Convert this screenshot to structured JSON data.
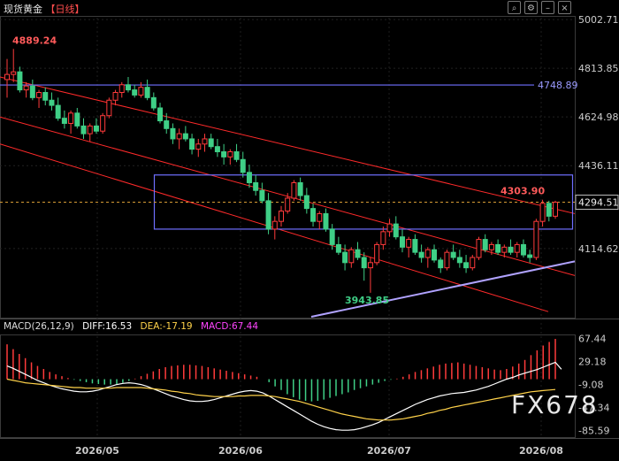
{
  "header": {
    "instrument": "现货黄金",
    "period": "【日线】"
  },
  "toolbar": {
    "icons": [
      "search-icon",
      "settings-icon",
      "minus-icon",
      "close-icon"
    ]
  },
  "watermark": "FX678",
  "macd": {
    "label": "MACD(26,12,9)",
    "diff": "DIFF:16.53",
    "dea": "DEA:-17.19",
    "macd": "MACD:67.44",
    "colors": {
      "diff": "#ffffff",
      "dea": "#ffd24a",
      "macd": "#ff44ff"
    }
  },
  "chart_data": [
    {
      "type": "candlestick",
      "title": "现货黄金 日线",
      "y_ticks": [
        "5002.71",
        "4813.85",
        "4624.98",
        "4436.11",
        "4114.62"
      ],
      "last_price": "4294.51",
      "annotations": {
        "high": "4889.24",
        "low": "3943.85",
        "recent_high": "4303.90",
        "level": "4748.89"
      },
      "x_ticks": [
        "2026/05",
        "2026/06",
        "2026/07",
        "2026/08"
      ],
      "colors": {
        "up": "#ff3b3b",
        "down": "#3fcf86",
        "channel": "#ff2a2a",
        "rect": "#6f6fff",
        "support": "#b0a2ff"
      },
      "candles": [
        [
          4770,
          4850,
          4700,
          4790
        ],
        [
          4790,
          4889,
          4760,
          4800
        ],
        [
          4800,
          4820,
          4720,
          4730
        ],
        [
          4730,
          4760,
          4700,
          4745
        ],
        [
          4745,
          4770,
          4690,
          4700
        ],
        [
          4700,
          4730,
          4660,
          4720
        ],
        [
          4720,
          4740,
          4670,
          4690
        ],
        [
          4690,
          4720,
          4650,
          4670
        ],
        [
          4670,
          4700,
          4610,
          4620
        ],
        [
          4620,
          4650,
          4580,
          4600
        ],
        [
          4600,
          4650,
          4560,
          4640
        ],
        [
          4640,
          4660,
          4580,
          4590
        ],
        [
          4590,
          4620,
          4540,
          4560
        ],
        [
          4560,
          4600,
          4530,
          4590
        ],
        [
          4590,
          4620,
          4560,
          4570
        ],
        [
          4570,
          4640,
          4560,
          4630
        ],
        [
          4630,
          4700,
          4620,
          4690
        ],
        [
          4690,
          4730,
          4670,
          4720
        ],
        [
          4720,
          4760,
          4700,
          4750
        ],
        [
          4750,
          4780,
          4720,
          4730
        ],
        [
          4730,
          4750,
          4700,
          4710
        ],
        [
          4710,
          4760,
          4700,
          4740
        ],
        [
          4740,
          4770,
          4690,
          4700
        ],
        [
          4700,
          4720,
          4650,
          4660
        ],
        [
          4660,
          4680,
          4600,
          4610
        ],
        [
          4610,
          4640,
          4560,
          4580
        ],
        [
          4580,
          4600,
          4520,
          4540
        ],
        [
          4540,
          4580,
          4500,
          4560
        ],
        [
          4560,
          4590,
          4530,
          4540
        ],
        [
          4540,
          4560,
          4480,
          4500
        ],
        [
          4500,
          4540,
          4470,
          4520
        ],
        [
          4520,
          4560,
          4490,
          4540
        ],
        [
          4540,
          4560,
          4500,
          4510
        ],
        [
          4510,
          4540,
          4470,
          4490
        ],
        [
          4490,
          4520,
          4440,
          4470
        ],
        [
          4470,
          4500,
          4440,
          4490
        ],
        [
          4490,
          4520,
          4450,
          4460
        ],
        [
          4460,
          4490,
          4390,
          4410
        ],
        [
          4410,
          4440,
          4350,
          4370
        ],
        [
          4370,
          4400,
          4320,
          4340
        ],
        [
          4340,
          4370,
          4290,
          4300
        ],
        [
          4300,
          4330,
          4170,
          4190
        ],
        [
          4190,
          4240,
          4150,
          4220
        ],
        [
          4220,
          4280,
          4200,
          4260
        ],
        [
          4260,
          4330,
          4250,
          4310
        ],
        [
          4310,
          4380,
          4300,
          4370
        ],
        [
          4370,
          4390,
          4300,
          4320
        ],
        [
          4320,
          4350,
          4250,
          4270
        ],
        [
          4270,
          4290,
          4200,
          4220
        ],
        [
          4220,
          4260,
          4190,
          4250
        ],
        [
          4250,
          4270,
          4180,
          4190
        ],
        [
          4190,
          4210,
          4110,
          4130
        ],
        [
          4130,
          4160,
          4090,
          4100
        ],
        [
          4100,
          4130,
          4030,
          4060
        ],
        [
          4060,
          4120,
          4040,
          4110
        ],
        [
          4110,
          4140,
          4070,
          4080
        ],
        [
          4080,
          4100,
          3990,
          4040
        ],
        [
          4040,
          4080,
          3943,
          4060
        ],
        [
          4060,
          4140,
          4050,
          4130
        ],
        [
          4130,
          4200,
          4110,
          4180
        ],
        [
          4180,
          4230,
          4160,
          4210
        ],
        [
          4210,
          4240,
          4150,
          4160
        ],
        [
          4160,
          4190,
          4100,
          4120
        ],
        [
          4120,
          4160,
          4080,
          4150
        ],
        [
          4150,
          4170,
          4090,
          4100
        ],
        [
          4100,
          4130,
          4060,
          4080
        ],
        [
          4080,
          4120,
          4040,
          4110
        ],
        [
          4110,
          4130,
          4060,
          4070
        ],
        [
          4070,
          4080,
          4020,
          4040
        ],
        [
          4040,
          4110,
          4030,
          4100
        ],
        [
          4100,
          4130,
          4070,
          4080
        ],
        [
          4080,
          4110,
          4040,
          4060
        ],
        [
          4060,
          4090,
          4020,
          4040
        ],
        [
          4040,
          4090,
          4030,
          4080
        ],
        [
          4080,
          4160,
          4070,
          4150
        ],
        [
          4150,
          4170,
          4100,
          4110
        ],
        [
          4110,
          4140,
          4090,
          4130
        ],
        [
          4130,
          4150,
          4090,
          4100
        ],
        [
          4100,
          4130,
          4080,
          4120
        ],
        [
          4120,
          4150,
          4090,
          4100
        ],
        [
          4100,
          4140,
          4080,
          4130
        ],
        [
          4130,
          4150,
          4080,
          4090
        ],
        [
          4090,
          4110,
          4060,
          4080
        ],
        [
          4080,
          4230,
          4070,
          4220
        ],
        [
          4220,
          4304,
          4200,
          4290
        ],
        [
          4290,
          4300,
          4220,
          4240
        ],
        [
          4240,
          4300,
          4230,
          4294
        ]
      ]
    },
    {
      "type": "bar",
      "title": "MACD(26,12,9)",
      "y_ticks": [
        "67.44",
        "29.18",
        "-9.08",
        "-47.34",
        "-85.59"
      ],
      "macd": [
        58,
        50,
        42,
        35,
        28,
        22,
        17,
        12,
        8,
        5,
        2,
        -1,
        -3,
        -5,
        -7,
        -8,
        -9,
        -9,
        -8,
        -6,
        -3,
        1,
        5,
        9,
        13,
        17,
        20,
        22,
        23,
        24,
        24,
        23,
        22,
        20,
        18,
        16,
        14,
        12,
        10,
        8,
        6,
        4,
        0,
        -5,
        -12,
        -18,
        -25,
        -30,
        -34,
        -36,
        -37,
        -36,
        -34,
        -31,
        -28,
        -25,
        -22,
        -18,
        -15,
        -12,
        -9,
        -6,
        -3,
        -1,
        1,
        4,
        8,
        12,
        15,
        18,
        21,
        24,
        26,
        27,
        28,
        26,
        24,
        22,
        20,
        18,
        16,
        15,
        17,
        21,
        26,
        32,
        40,
        48,
        56,
        62,
        67
      ],
      "diff": [
        22,
        18,
        13,
        8,
        3,
        -2,
        -6,
        -10,
        -13,
        -16,
        -18,
        -20,
        -21,
        -21,
        -20,
        -18,
        -15,
        -12,
        -9,
        -7,
        -6,
        -7,
        -9,
        -12,
        -16,
        -20,
        -24,
        -28,
        -31,
        -34,
        -36,
        -37,
        -37,
        -36,
        -34,
        -31,
        -28,
        -25,
        -22,
        -20,
        -19,
        -20,
        -23,
        -28,
        -34,
        -40,
        -46,
        -52,
        -58,
        -64,
        -70,
        -75,
        -79,
        -82,
        -84,
        -85,
        -85,
        -84,
        -82,
        -79,
        -76,
        -72,
        -67,
        -62,
        -57,
        -52,
        -47,
        -42,
        -38,
        -34,
        -31,
        -28,
        -26,
        -24,
        -23,
        -22,
        -20,
        -18,
        -15,
        -12,
        -8,
        -4,
        0,
        3,
        7,
        10,
        13,
        16,
        20,
        24,
        28,
        16.53
      ],
      "dea": [
        0,
        -2,
        -4,
        -6,
        -7,
        -8,
        -9,
        -10,
        -11,
        -12,
        -13,
        -14,
        -14,
        -15,
        -15,
        -15,
        -15,
        -15,
        -14,
        -14,
        -14,
        -14,
        -14,
        -15,
        -16,
        -17,
        -18,
        -20,
        -21,
        -23,
        -24,
        -26,
        -27,
        -28,
        -29,
        -29,
        -29,
        -29,
        -28,
        -28,
        -27,
        -27,
        -27,
        -28,
        -29,
        -31,
        -33,
        -35,
        -37,
        -40,
        -43,
        -46,
        -49,
        -52,
        -55,
        -58,
        -60,
        -62,
        -64,
        -66,
        -67,
        -68,
        -68,
        -68,
        -67,
        -66,
        -64,
        -62,
        -60,
        -57,
        -55,
        -52,
        -50,
        -47,
        -45,
        -43,
        -41,
        -39,
        -37,
        -35,
        -33,
        -31,
        -29,
        -27,
        -25,
        -23,
        -21,
        -20,
        -19,
        -18,
        -17.19
      ]
    }
  ]
}
